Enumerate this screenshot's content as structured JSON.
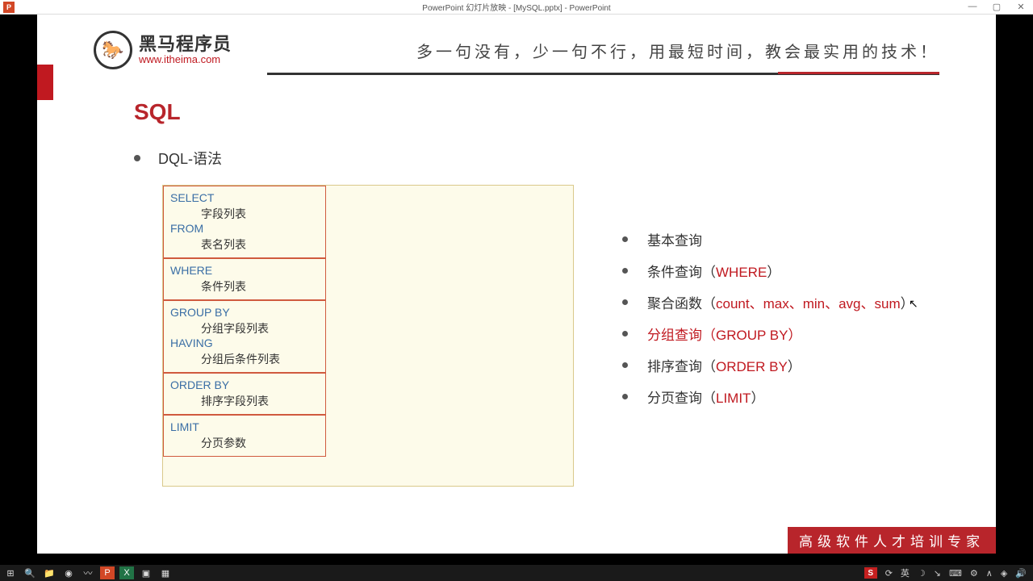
{
  "window": {
    "app_icon": "P",
    "title": "PowerPoint 幻灯片放映 - [MySQL.pptx] - PowerPoint",
    "min": "—",
    "max": "▢",
    "close": "✕"
  },
  "header": {
    "logo_cn": "黑马程序员",
    "logo_url": "www.itheima.com",
    "tagline": "多一句没有，少一句不行，用最短时间，教会最实用的技术！"
  },
  "section_title": "SQL",
  "sub_bullet": "DQL-语法",
  "syntax": [
    {
      "segments": [
        {
          "kw": "SELECT",
          "desc": "字段列表"
        },
        {
          "kw": "FROM",
          "desc": "表名列表"
        }
      ]
    },
    {
      "segments": [
        {
          "kw": "WHERE",
          "desc": "条件列表"
        }
      ]
    },
    {
      "segments": [
        {
          "kw": "GROUP  BY",
          "desc": "分组字段列表"
        },
        {
          "kw": "HAVING",
          "desc": "分组后条件列表"
        }
      ]
    },
    {
      "segments": [
        {
          "kw": "ORDER BY",
          "desc": "排序字段列表"
        }
      ]
    },
    {
      "segments": [
        {
          "kw": "LIMIT",
          "desc": "分页参数"
        }
      ]
    }
  ],
  "right_list": [
    {
      "pre": "基本查询",
      "hl": "",
      "post": "",
      "all_hl": false
    },
    {
      "pre": "条件查询（",
      "hl": "WHERE",
      "post": "）",
      "all_hl": false
    },
    {
      "pre": "聚合函数（",
      "hl": "count、max、min、avg、sum",
      "post": "）",
      "all_hl": false
    },
    {
      "pre": "分组查询（GROUP BY）",
      "hl": "",
      "post": "",
      "all_hl": true
    },
    {
      "pre": "排序查询（",
      "hl": "ORDER BY",
      "post": "）",
      "all_hl": false
    },
    {
      "pre": "分页查询（",
      "hl": "LIMIT",
      "post": "）",
      "all_hl": false
    }
  ],
  "footer_banner": "高级软件人才培训专家",
  "tray": {
    "s": "S",
    "ime": "英",
    "moon": "☽",
    "arrow": "↘",
    "kb": "⌨",
    "gear": "⚙",
    "chevron": "∧",
    "net": "◈",
    "vol": "🔊"
  }
}
